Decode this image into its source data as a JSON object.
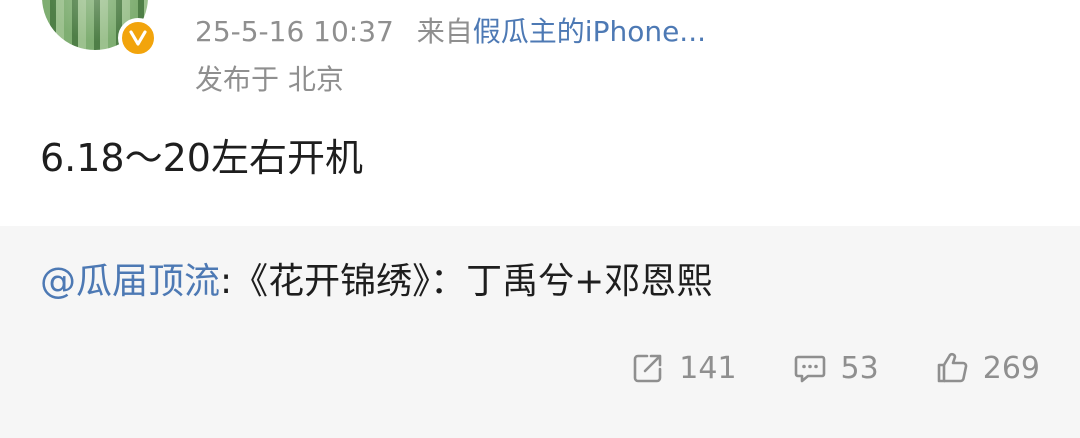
{
  "post": {
    "timestamp": "25-5-16 10:37",
    "source_prefix": "来自",
    "device": "假瓜主的iPhone...",
    "location": "发布于 北京",
    "text": "6.18～20左右开机"
  },
  "repost": {
    "mention": "@瓜届顶流",
    "content": ":《花开锦绣》：丁禹兮+邓恩熙"
  },
  "actions": {
    "repost_count": "141",
    "comment_count": "53",
    "like_count": "269"
  },
  "colors": {
    "link": "#4d79b4",
    "badge": "#f2a40c",
    "muted": "#8f8f8f"
  }
}
